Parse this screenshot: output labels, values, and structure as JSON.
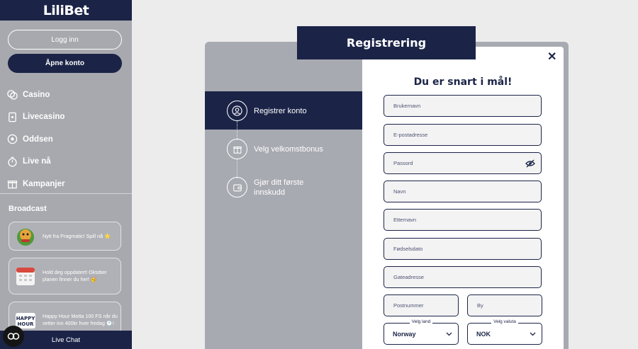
{
  "sidebar": {
    "logo": "LiliBet",
    "login_label": "Logg inn",
    "open_account_label": "Åpne konto",
    "nav": [
      {
        "label": "Casino",
        "icon": "casino-chip-icon"
      },
      {
        "label": "Livecasino",
        "icon": "playing-card-icon"
      },
      {
        "label": "Oddsen",
        "icon": "soccer-ball-icon"
      },
      {
        "label": "Live nå",
        "icon": "stopwatch-icon"
      },
      {
        "label": "Kampanjer",
        "icon": "gift-icon"
      }
    ],
    "broadcast_title": "Broadcast",
    "broadcast": [
      {
        "text": "Nytt fra Pragmatic! Spill nå ⭐",
        "icon": "dragon-mascot-icon"
      },
      {
        "text": "Hold deg oppdatert! Oktober planen finner du her! 🥳",
        "icon": "calendar-icon"
      },
      {
        "text": "Happy Hour Motta 100 FS når du setter inn 400kr hver fredag 🕐!",
        "icon": "happy-hour-icon"
      }
    ],
    "live_chat_label": "Live Chat"
  },
  "modal": {
    "title": "Registrering",
    "heading": "Du er snart i mål!",
    "steps": [
      {
        "label": "Registrer konto",
        "icon": "user-icon",
        "active": true
      },
      {
        "label": "Velg velkomstbonus",
        "icon": "gift-icon",
        "active": false
      },
      {
        "label": "Gjør ditt første innskudd",
        "icon": "wallet-icon",
        "active": false
      }
    ],
    "fields": {
      "username": "Brukernavn",
      "email": "E-postadresse",
      "password": "Passord",
      "first_name": "Navn",
      "last_name": "Etternavn",
      "birth_date": "Fødselsdato",
      "address": "Gateadresse",
      "postcode": "Postnummer",
      "city": "By"
    },
    "country": {
      "legend": "Velg land",
      "value": "Norway"
    },
    "currency": {
      "legend": "Velg valuta",
      "value": "NOK"
    }
  },
  "colors": {
    "navy": "#1b2447",
    "sidebar": "#a8a9ae",
    "panel": "#a8aab1"
  }
}
